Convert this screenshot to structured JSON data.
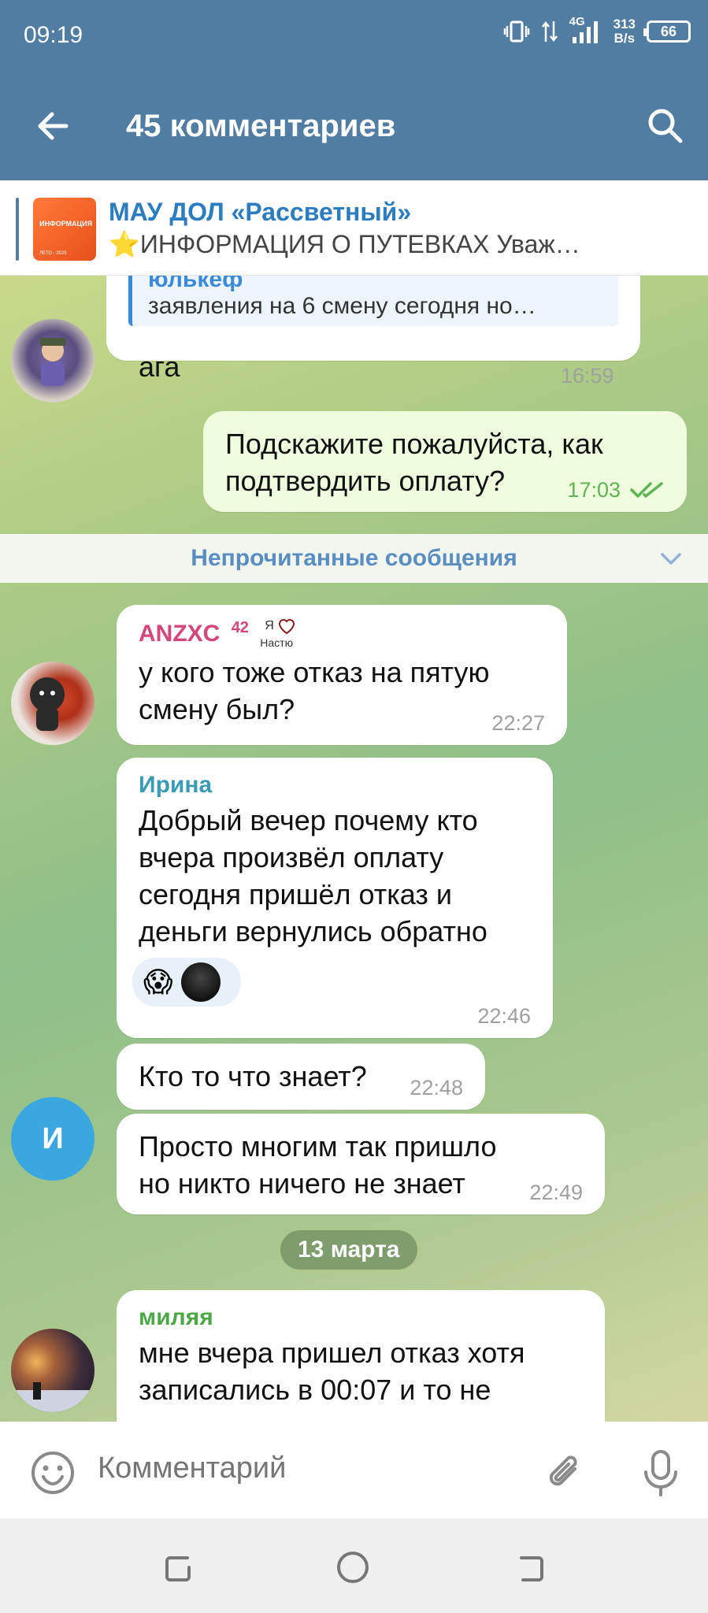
{
  "status_bar": {
    "time": "09:19",
    "network": "4G",
    "speed_value": "313",
    "speed_unit": "B/s",
    "battery": "66"
  },
  "header": {
    "title": "45 комментариев",
    "back_icon": "arrow-left-icon",
    "search_icon": "search-icon"
  },
  "pinned": {
    "title": "МАУ ДОЛ «Рассветный»",
    "subtitle": "⭐ИНФОРМАЦИЯ О ПУТЕВКАХ  Уваж…",
    "thumb_line1": "ИНФОРМАЦИЯ",
    "thumb_line2": "ЛЕТО - 2025"
  },
  "messages": [
    {
      "reply_name": "юлькеф",
      "reply_text": "заявления на 6 смену сегодня но…",
      "text": "ага",
      "time": "16:59"
    },
    {
      "text_lines": [
        "Подскажите пожалуйста, как",
        "подтвердить оплату?"
      ],
      "time": "17:03"
    },
    {
      "sender": "ANZXC",
      "sender_badge": "42",
      "sender_tag1": "Я",
      "sender_tag2": "Настю",
      "text_lines": [
        "у кого тоже отказ на пятую",
        "смену был?"
      ],
      "time": "22:27"
    },
    {
      "sender": "Ирина",
      "text_lines": [
        "Добрый вечер почему кто",
        "вчера произвёл оплату",
        "сегодня пришёл отказ и",
        "деньги вернулись обратно"
      ],
      "reaction": "😱",
      "time": "22:46"
    },
    {
      "text": "Кто то что знает?",
      "time": "22:48"
    },
    {
      "text_lines": [
        "Просто многим так пришло",
        "но никто ничего не знает"
      ],
      "time": "22:49",
      "avatar_letter": "И"
    },
    {
      "sender": "миляя",
      "text_lines": [
        "мне вчера пришел отказ хотя",
        "записались в 00:07 и то не"
      ]
    }
  ],
  "unread_divider": "Непрочитанные сообщения",
  "date_chip": "13 марта",
  "composer": {
    "placeholder": "Комментарий"
  },
  "colors": {
    "header": "#517da2",
    "sender_anzxc": "#d4477a",
    "sender_irina": "#3a9bb5",
    "sender_milyaya": "#4ca847",
    "avatar_i": "#3aa7e0"
  }
}
